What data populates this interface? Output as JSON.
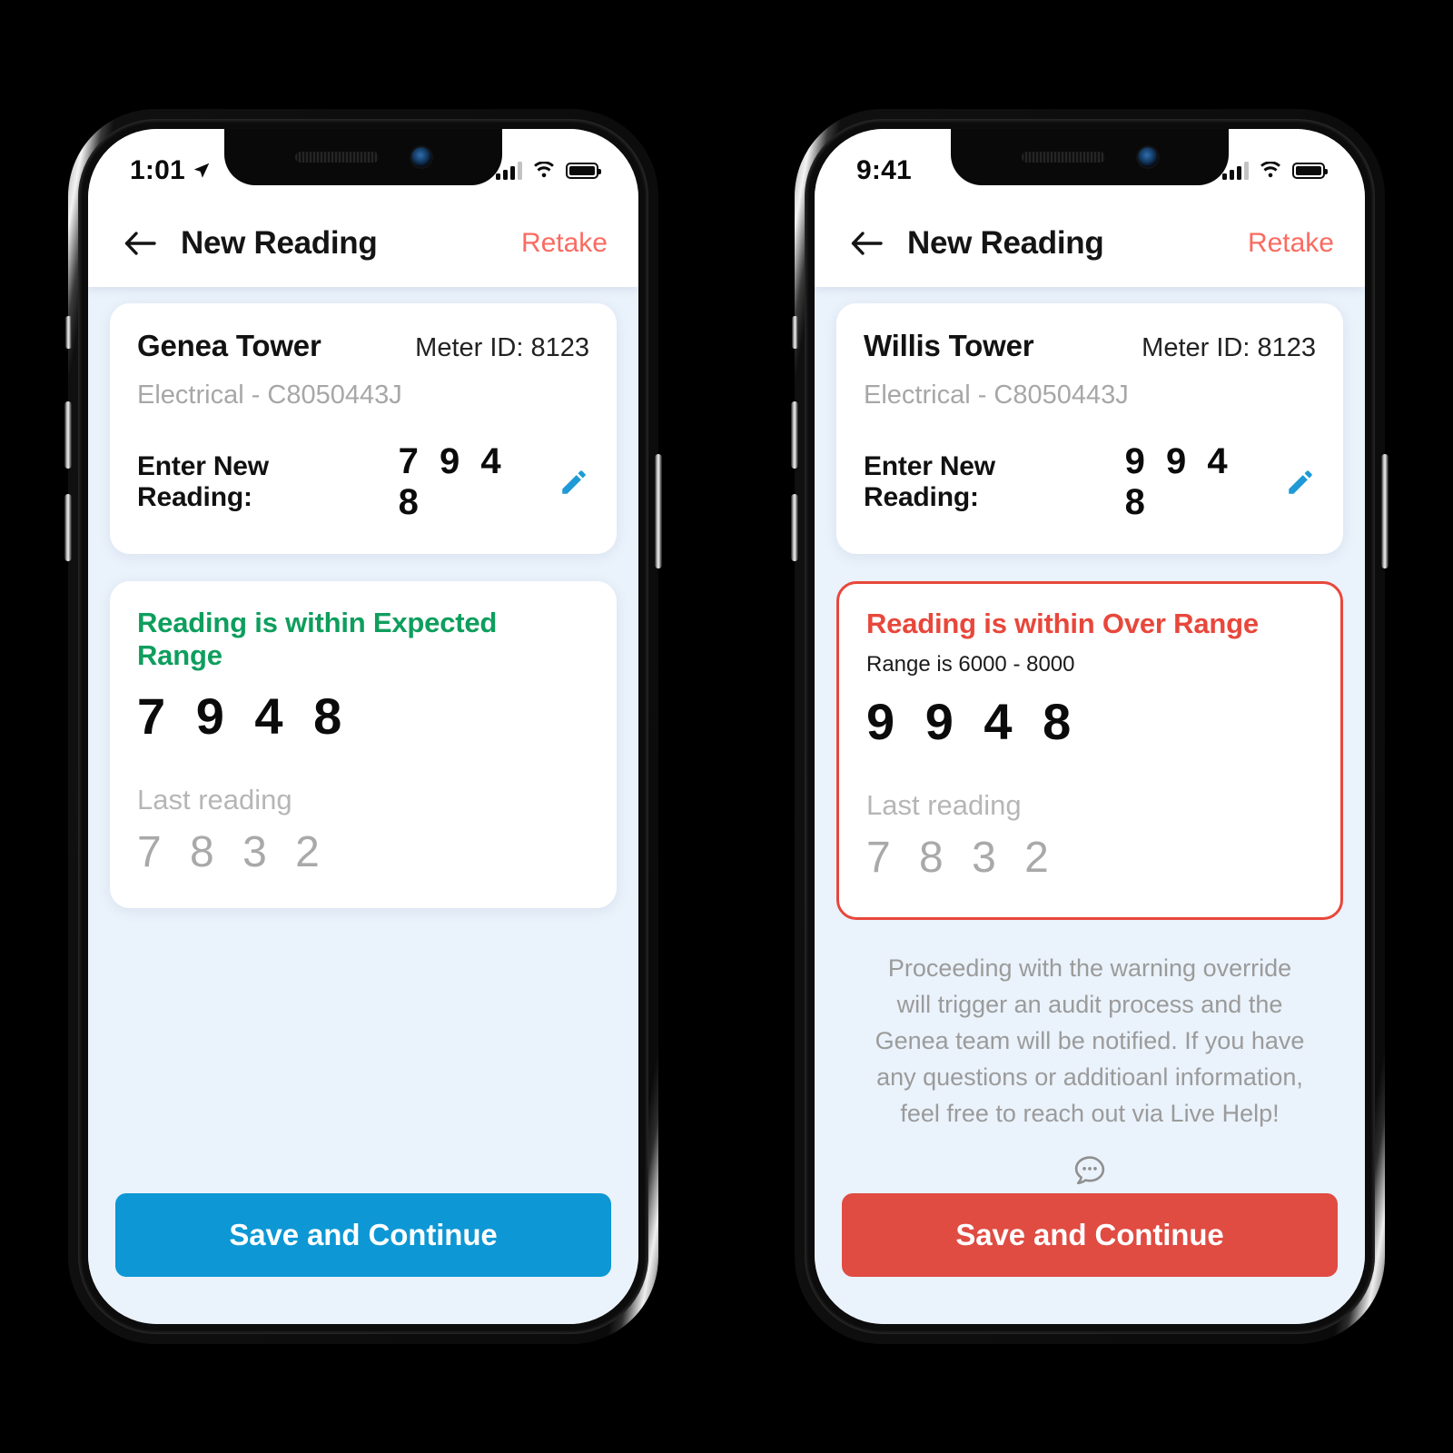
{
  "screens": [
    {
      "id": "expected-range",
      "statusbar": {
        "time": "1:01",
        "location_arrow": "location-arrow-icon",
        "signal": "signal-bars-icon",
        "wifi": "wifi-icon",
        "battery": "battery-icon"
      },
      "navbar": {
        "back": "back-arrow-icon",
        "title": "New Reading",
        "action": "Retake"
      },
      "meter_card": {
        "name": "Genea Tower",
        "meter_id": "Meter ID: 8123",
        "subtitle": "Electrical - C8050443J",
        "enter_label": "Enter New Reading:",
        "enter_value": "7 9 4 8",
        "edit_icon": "pencil-icon"
      },
      "status_card": {
        "variant": "ok",
        "title": "Reading is within Expected Range",
        "range": "",
        "value": "7 9 4 8",
        "last_label": "Last reading",
        "last_value": "7 8 3 2"
      },
      "warning_note": "",
      "help_icon": "",
      "cta": {
        "label": "Save and Continue",
        "color": "#0d97d4"
      }
    },
    {
      "id": "over-range",
      "statusbar": {
        "time": "9:41",
        "location_arrow": "",
        "signal": "signal-bars-icon",
        "wifi": "wifi-icon",
        "battery": "battery-icon"
      },
      "navbar": {
        "back": "back-arrow-icon",
        "title": "New Reading",
        "action": "Retake"
      },
      "meter_card": {
        "name": "Willis Tower",
        "meter_id": "Meter ID: 8123",
        "subtitle": "Electrical - C8050443J",
        "enter_label": "Enter New Reading:",
        "enter_value": "9 9 4 8",
        "edit_icon": "pencil-icon"
      },
      "status_card": {
        "variant": "over",
        "title": "Reading is within Over Range",
        "range": "Range is 6000 - 8000",
        "value": "9 9 4 8",
        "last_label": "Last reading",
        "last_value": "7 8 3 2"
      },
      "warning_note": "Proceeding with the warning override will trigger an audit process and the Genea team will be notified. If you have any questions or additioanl information, feel free to reach out via Live Help!",
      "help_icon": "chat-bubble-icon",
      "cta": {
        "label": "Save and Continue",
        "color": "#e04b42"
      }
    }
  ],
  "colors": {
    "background": "#000000",
    "app_background": "#eaf2fb",
    "accent_blue": "#0d97d4",
    "accent_red": "#e04b42",
    "status_ok_green": "#0e9e5d",
    "status_over_red": "#e8473b",
    "retake_coral": "#fa6b61",
    "muted_gray": "#a7a7a7"
  }
}
